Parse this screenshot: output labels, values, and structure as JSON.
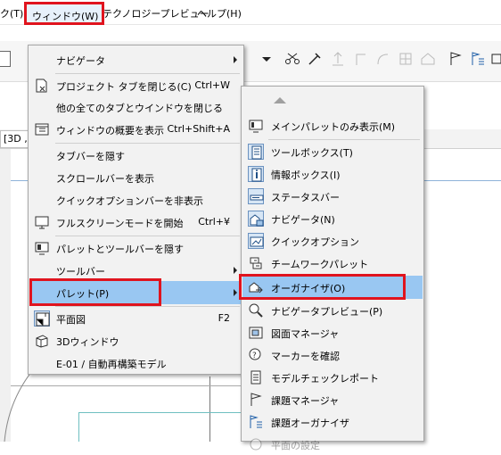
{
  "menubar": {
    "items": [
      "ク(T)",
      "ウィンドウ(W)",
      "テクノロジープレビュー",
      "ヘルプ(H)"
    ]
  },
  "window_menu": {
    "items": [
      {
        "label": "ナビゲータ",
        "shortcut": "",
        "submenu": true,
        "icon": "none"
      },
      {
        "label": "プロジェクト タブを閉じる(C)",
        "shortcut": "Ctrl+W",
        "icon": "close-tab-icon"
      },
      {
        "label": "他の全てのタブとウインドウを閉じる",
        "shortcut": "",
        "icon": "none"
      },
      {
        "label": "ウィンドウの概要を表示",
        "shortcut": "Ctrl+Shift+A",
        "icon": "window-overview-icon"
      },
      {
        "label": "タブバーを隠す",
        "shortcut": "",
        "icon": "none"
      },
      {
        "label": "スクロールバーを表示",
        "shortcut": "",
        "icon": "none"
      },
      {
        "label": "クイックオプションバーを非表示",
        "shortcut": "",
        "icon": "none"
      },
      {
        "label": "フルスクリーンモードを開始",
        "shortcut": "Ctrl+¥",
        "icon": "fullscreen-icon"
      },
      {
        "label": "パレットとツールバーを隠す",
        "shortcut": "",
        "icon": "hide-palettes-icon"
      },
      {
        "label": "ツールバー",
        "shortcut": "",
        "submenu": true,
        "icon": "none"
      },
      {
        "label": "パレット(P)",
        "shortcut": "",
        "submenu": true,
        "icon": "none"
      },
      {
        "label": "平面図",
        "shortcut": "F2",
        "icon": "floor-plan-icon"
      },
      {
        "label": "3Dウィンドウ",
        "shortcut": "",
        "icon": "3d-window-icon"
      },
      {
        "label": "E-01 / 自動再構築モデル",
        "shortcut": "",
        "icon": "none"
      }
    ]
  },
  "palette_submenu": {
    "items": [
      {
        "label": "メインパレットのみ表示(M)",
        "icon": "main-palette-icon"
      },
      {
        "label": "ツールボックス(T)",
        "icon": "toolbox-icon"
      },
      {
        "label": "情報ボックス(I)",
        "icon": "info-box-icon"
      },
      {
        "label": "ステータスバー",
        "icon": "status-bar-icon"
      },
      {
        "label": "ナビゲータ(N)",
        "icon": "navigator-icon"
      },
      {
        "label": "クイックオプション",
        "icon": "quick-options-icon"
      },
      {
        "label": "チームワークパレット",
        "icon": "teamwork-icon"
      },
      {
        "label": "オーガナイザ(O)",
        "icon": "organizer-icon"
      },
      {
        "label": "ナビゲータプレビュー(P)",
        "icon": "navigator-preview-icon"
      },
      {
        "label": "図面マネージャ",
        "icon": "drawing-manager-icon"
      },
      {
        "label": "マーカーを確認",
        "icon": "marker-check-icon"
      },
      {
        "label": "モデルチェックレポート",
        "icon": "model-check-icon"
      },
      {
        "label": "課題マネージャ",
        "icon": "issue-manager-icon"
      },
      {
        "label": "課題オーガナイザ",
        "icon": "issue-organizer-icon"
      },
      {
        "label": "平面の設定",
        "icon": "plane-settings-icon"
      }
    ]
  },
  "background": {
    "tab_label": "[3D ,"
  },
  "colors": {
    "highlight": "#99c7f2",
    "annotation_red": "#e0141e",
    "menu_bg": "#f2f2f2"
  }
}
